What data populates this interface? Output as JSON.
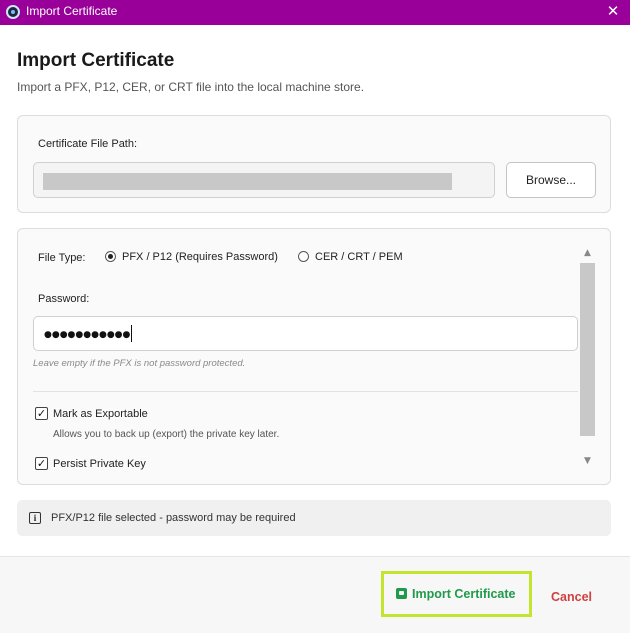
{
  "window": {
    "title": "Import Certificate",
    "app_icon": "app-icon",
    "close_icon": "close-icon"
  },
  "header": {
    "title": "Import Certificate",
    "subtitle": "Import a PFX, P12, CER, or CRT file into the local machine store."
  },
  "file_section": {
    "label": "Certificate File Path:",
    "path_value": "",
    "browse_label": "Browse..."
  },
  "options": {
    "file_type_label": "File Type:",
    "file_types": [
      {
        "label": "PFX / P12 (Requires Password)",
        "selected": true
      },
      {
        "label": "CER / CRT / PEM",
        "selected": false
      }
    ],
    "password_label": "Password:",
    "password_value": "●●●●●●●●●●●",
    "password_hint": "Leave empty if the PFX is not password protected.",
    "exportable": {
      "label": "Mark as Exportable",
      "checked": true,
      "description": "Allows you to back up (export) the private key later."
    },
    "persist": {
      "label": "Persist Private Key",
      "checked": true
    }
  },
  "status": {
    "icon": "info-icon",
    "text": "PFX/P12 file selected - password may be required"
  },
  "footer": {
    "import_label": "Import Certificate",
    "import_icon": "certificate-icon",
    "cancel_label": "Cancel"
  },
  "colors": {
    "titlebar": "#990099",
    "import_text": "#1f9a4a",
    "import_highlight": "#c4e530",
    "cancel_text": "#d04040"
  }
}
